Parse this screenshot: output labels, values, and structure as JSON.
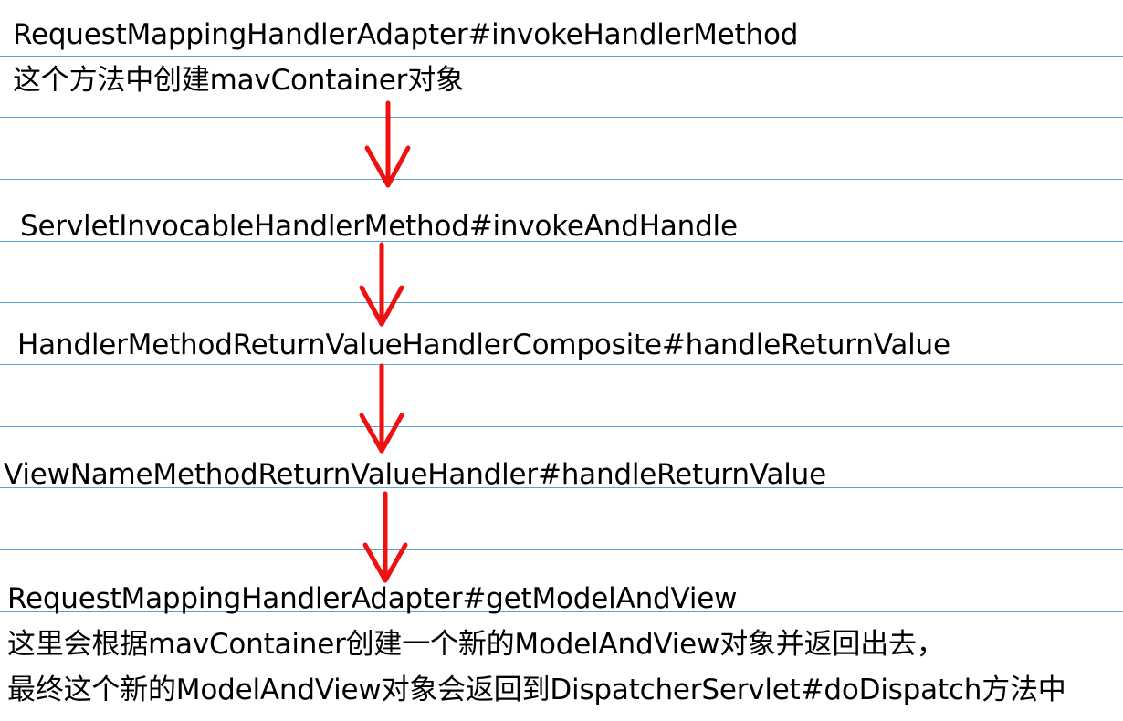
{
  "colors": {
    "rule_line": "#5aa0dc",
    "arrow": "#ee1111",
    "text": "#000000"
  },
  "steps": [
    {
      "method": "RequestMappingHandlerAdapter#invokeHandlerMethod",
      "note": "这个方法中创建mavContainer对象"
    },
    {
      "method": "ServletInvocableHandlerMethod#invokeAndHandle"
    },
    {
      "method": "HandlerMethodReturnValueHandlerComposite#handleReturnValue"
    },
    {
      "method": "ViewNameMethodReturnValueHandler#handleReturnValue"
    },
    {
      "method": "RequestMappingHandlerAdapter#getModelAndView",
      "note": "这里会根据mavContainer创建一个新的ModelAndView对象并返回出去，",
      "note2": "最终这个新的ModelAndView对象会返回到DispatcherServlet#doDispatch方法中"
    }
  ],
  "arrows": [
    {
      "from": "step-1",
      "to": "step-2",
      "icon": "down-arrow-icon"
    },
    {
      "from": "step-2",
      "to": "step-3",
      "icon": "down-arrow-icon"
    },
    {
      "from": "step-3",
      "to": "step-4",
      "icon": "down-arrow-icon"
    },
    {
      "from": "step-4",
      "to": "step-5",
      "icon": "down-arrow-icon"
    }
  ]
}
